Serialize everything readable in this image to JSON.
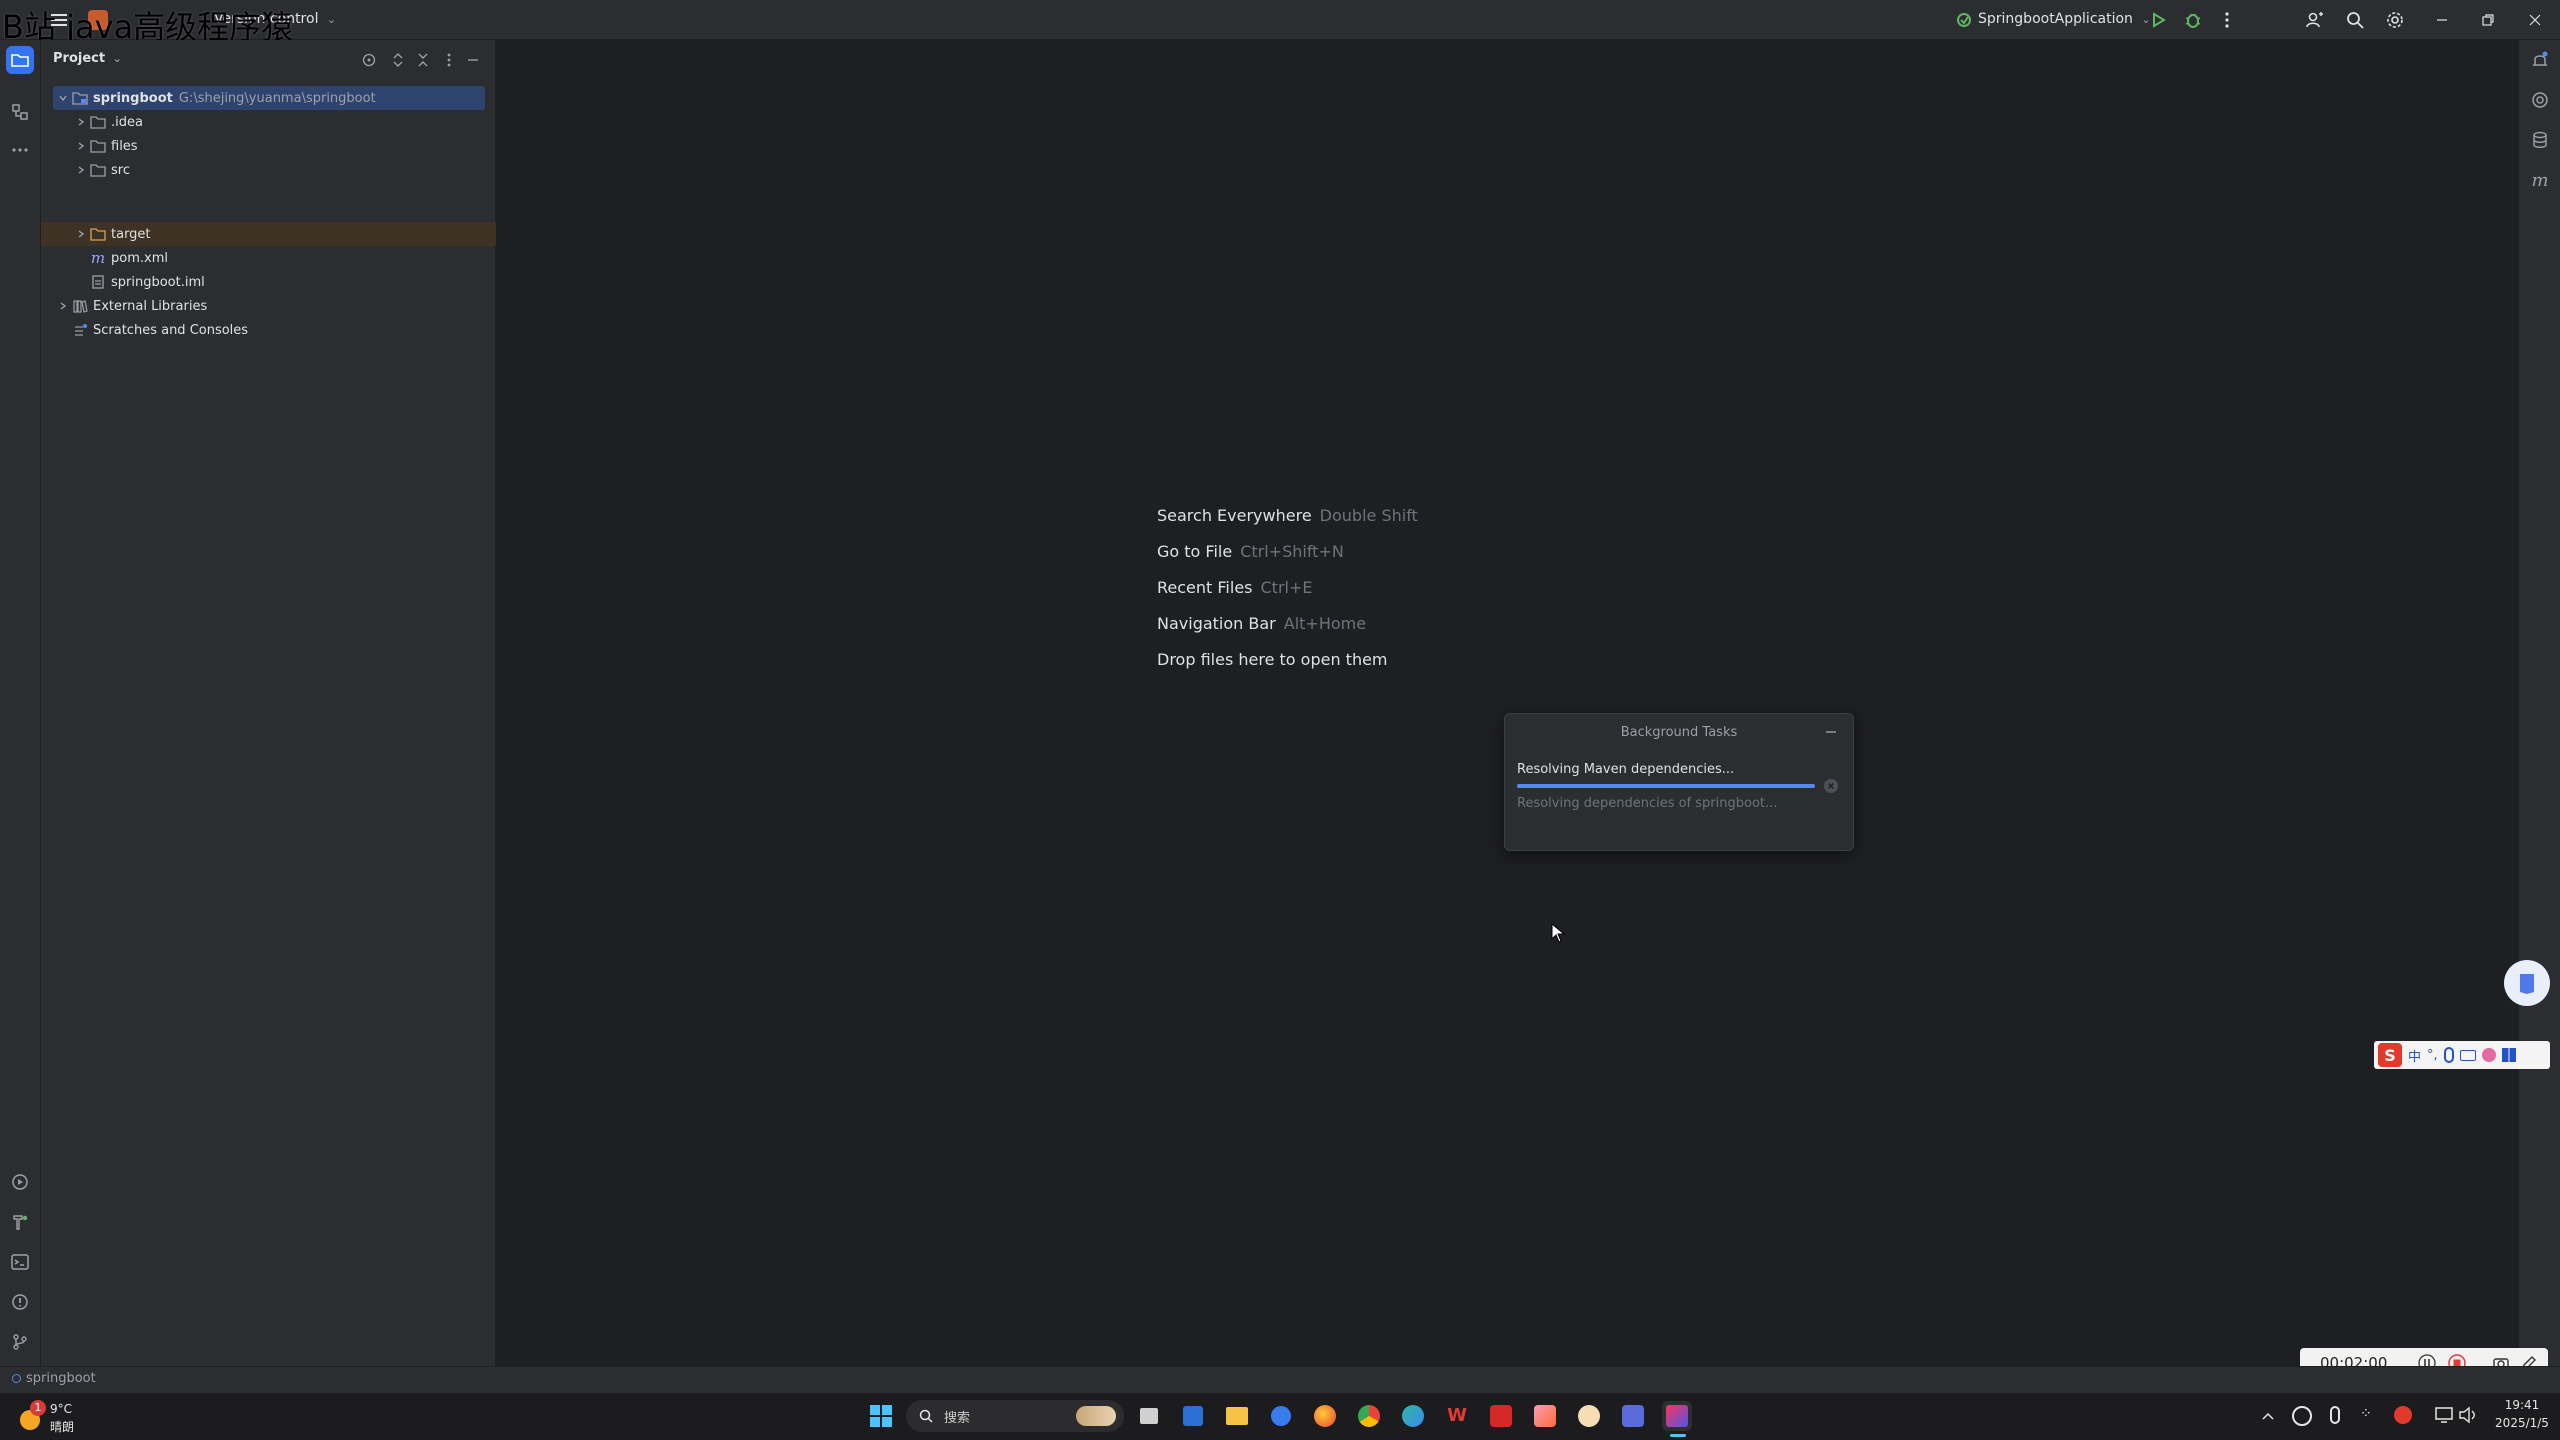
{
  "watermark": "B站 java高级程序猿",
  "titlebar": {
    "vcs_label": "Version control",
    "run_config": "SpringbootApplication",
    "colors": {
      "run": "#5fb85f",
      "debug": "#5fb85f"
    }
  },
  "project_panel": {
    "title": "Project",
    "tree": [
      {
        "label": "springboot",
        "path": "G:\\shejing\\yuanma\\springboot",
        "icon": "module-folder-icon"
      },
      {
        "label": ".idea",
        "icon": "folder-icon"
      },
      {
        "label": "files",
        "icon": "folder-icon"
      },
      {
        "label": "src",
        "icon": "folder-icon"
      },
      {
        "label": "target",
        "icon": "folder-icon"
      },
      {
        "label": "pom.xml",
        "icon": "maven-icon"
      },
      {
        "label": "springboot.iml",
        "icon": "iml-file-icon"
      },
      {
        "label": "External Libraries",
        "icon": "library-icon"
      },
      {
        "label": "Scratches and Consoles",
        "icon": "scratches-icon"
      }
    ]
  },
  "editor_hints": [
    {
      "action": "Search Everywhere",
      "shortcut": "Double Shift"
    },
    {
      "action": "Go to File",
      "shortcut": "Ctrl+Shift+N"
    },
    {
      "action": "Recent Files",
      "shortcut": "Ctrl+E"
    },
    {
      "action": "Navigation Bar",
      "shortcut": "Alt+Home"
    },
    {
      "action": "Drop files here to open them",
      "shortcut": ""
    }
  ],
  "background_tasks": {
    "title": "Background Tasks",
    "task": "Resolving Maven dependencies...",
    "detail": "Resolving dependencies of springboot...",
    "progress": 1.0,
    "accent": "#548af7"
  },
  "statusbar": {
    "project": "springboot"
  },
  "recorder": {
    "time": "00:02:00"
  },
  "taskbar": {
    "weather_badge": "1",
    "weather_temp": "9°C",
    "weather_desc": "晴朗",
    "search_placeholder": "搜索",
    "ime_label": "中",
    "clock_time": "19:41",
    "clock_date": "2025/1/5"
  }
}
